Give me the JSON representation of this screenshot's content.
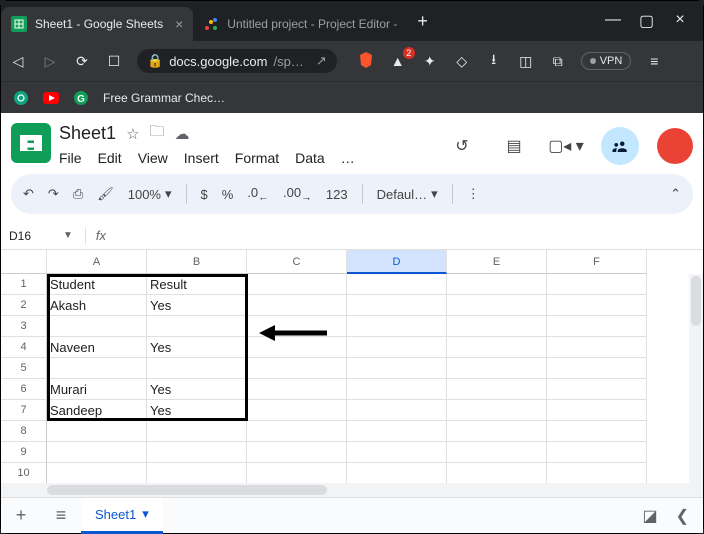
{
  "browser": {
    "tabs": [
      {
        "title": "Sheet1 - Google Sheets",
        "active": true
      },
      {
        "title": "Untitled project - Project Editor -",
        "active": false
      }
    ],
    "url_prefix": "docs.google.com",
    "url_suffix": "/sp…",
    "vpn_label": "VPN",
    "ext_badge": "2",
    "bookmarks": {
      "grammar_label": "Free Grammar Chec…"
    }
  },
  "sheets": {
    "doc_title": "Sheet1",
    "menus": [
      "File",
      "Edit",
      "View",
      "Insert",
      "Format",
      "Data",
      "…"
    ],
    "toolbar": {
      "zoom": "100%",
      "currency": "$",
      "percent": "%",
      "dec_dec": ".0",
      "inc_dec": ".00",
      "num_fmt": "123",
      "font": "Defaul…",
      "more": "⋮"
    },
    "cell_ref": "D16",
    "fx_value": "",
    "columns": [
      "A",
      "B",
      "C",
      "D",
      "E",
      "F"
    ],
    "selected_col": "D",
    "rows": [
      {
        "n": 1,
        "A": "Student",
        "B": "Result"
      },
      {
        "n": 2,
        "A": "Akash",
        "B": "Yes"
      },
      {
        "n": 3,
        "A": "",
        "B": ""
      },
      {
        "n": 4,
        "A": "Naveen",
        "B": "Yes"
      },
      {
        "n": 5,
        "A": "",
        "B": ""
      },
      {
        "n": 6,
        "A": "Murari",
        "B": "Yes"
      },
      {
        "n": 7,
        "A": "Sandeep",
        "B": "Yes"
      },
      {
        "n": 8,
        "A": "",
        "B": ""
      },
      {
        "n": 9,
        "A": "",
        "B": ""
      },
      {
        "n": 10,
        "A": "",
        "B": ""
      }
    ],
    "sheet_tab": "Sheet1"
  }
}
